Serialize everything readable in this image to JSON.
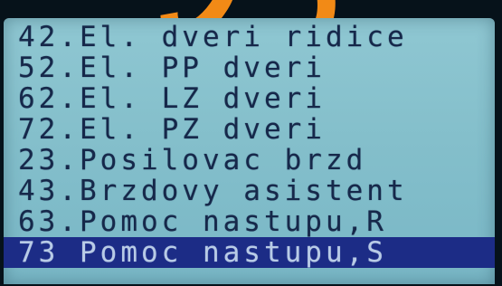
{
  "menu": {
    "items": [
      {
        "label": "42.El. dveri ridice",
        "selected": false
      },
      {
        "label": "52.El. PP dveri",
        "selected": false
      },
      {
        "label": "62.El. LZ dveri",
        "selected": false
      },
      {
        "label": "72.El. PZ dveri",
        "selected": false
      },
      {
        "label": "23.Posilovac brzd",
        "selected": false
      },
      {
        "label": "43.Brzdovy asistent",
        "selected": false
      },
      {
        "label": "63.Pomoc nastupu,R",
        "selected": false
      },
      {
        "label": "73 Pomoc nastupu,S",
        "selected": true
      }
    ]
  },
  "colors": {
    "screen_background": "#86c1cd",
    "text": "#16284a",
    "selection_background": "#1c2c86",
    "selection_text": "#b8cbe6",
    "bezel_accent": "#f28a16"
  }
}
